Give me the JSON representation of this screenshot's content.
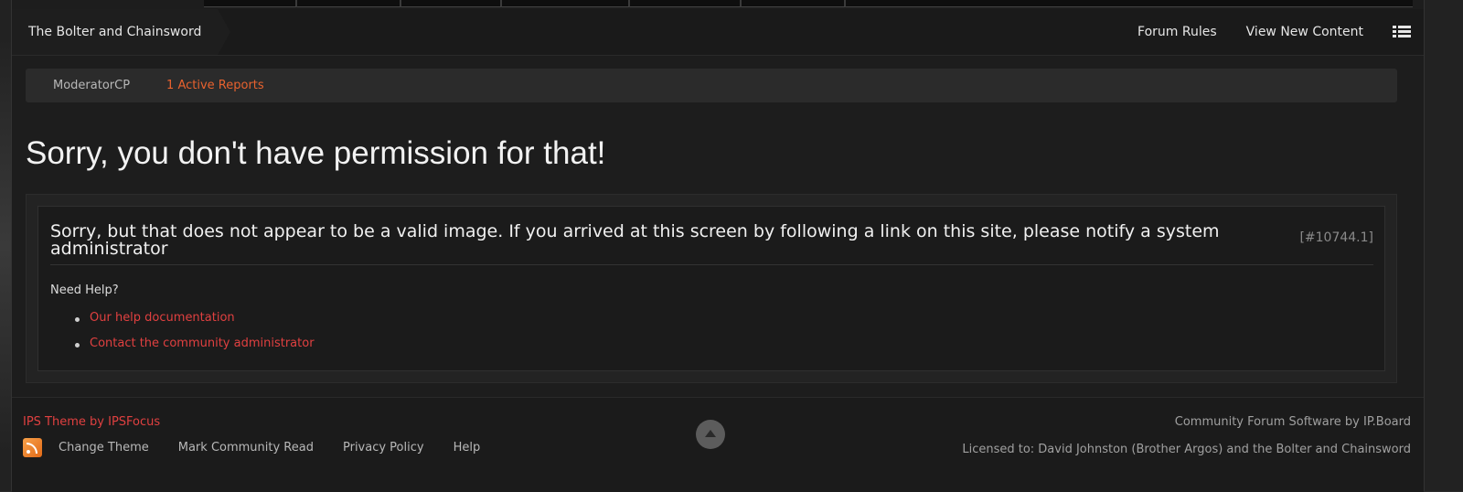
{
  "header": {
    "site_name": "The Bolter and Chainsword",
    "nav": [
      "Forum Rules",
      "View New Content"
    ],
    "menu_icon": "list-icon"
  },
  "modbar": {
    "moderator_cp": "ModeratorCP",
    "reports": "1 Active Reports"
  },
  "main": {
    "title": "Sorry, you don't have permission for that!",
    "error_message": "Sorry, but that does not appear to be a valid image. If you arrived at this screen by following a link on this site, please notify a system administrator",
    "error_code": "[#10744.1]",
    "help_heading": "Need Help?",
    "help_links": [
      "Our help documentation",
      "Contact the community administrator"
    ]
  },
  "footer": {
    "theme_credit": "IPS Theme by IPSFocus",
    "links": [
      "Change Theme",
      "Mark Community Read",
      "Privacy Policy",
      "Help"
    ],
    "powered_by": "Community Forum Software by IP.Board",
    "licensed_to": "Licensed to: David Johnston (Brother Argos) and the Bolter and Chainsword",
    "rss_icon": "rss-icon",
    "back_to_top_icon": "arrow-up-icon"
  },
  "colors": {
    "accent_red": "#e04040",
    "report_orange": "#e8622e",
    "background": "#1d1d1d"
  }
}
